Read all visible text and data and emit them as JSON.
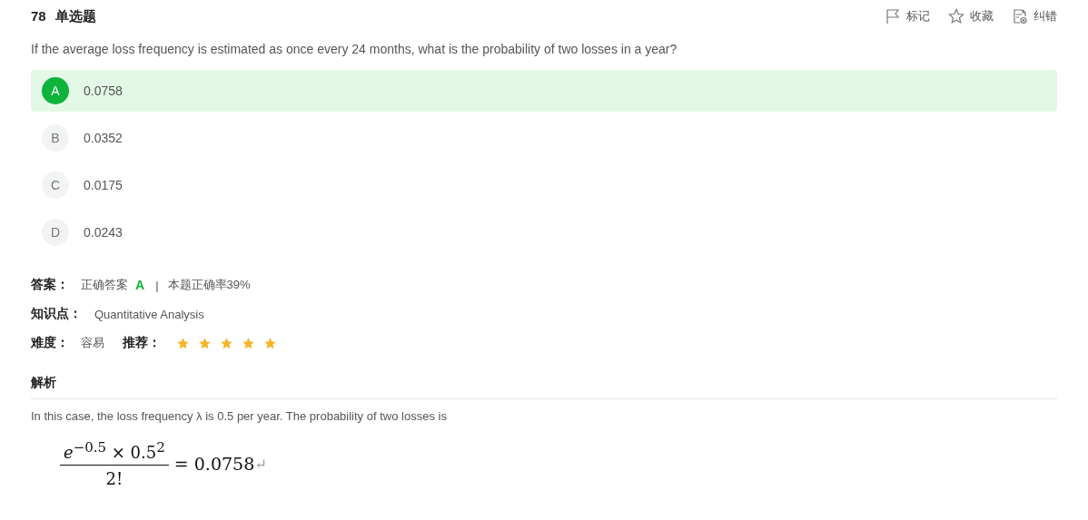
{
  "question": {
    "number": "78",
    "type": "单选题",
    "text": "If the average loss frequency is estimated as once every 24 months, what is the probability of two losses in a year?"
  },
  "actions": [
    {
      "kind": "flag",
      "label": "标记"
    },
    {
      "kind": "star",
      "label": "收藏"
    },
    {
      "kind": "report",
      "label": "纠错"
    }
  ],
  "options": [
    {
      "letter": "A",
      "text": "0.0758",
      "selected": true
    },
    {
      "letter": "B",
      "text": "0.0352",
      "selected": false
    },
    {
      "letter": "C",
      "text": "0.0175",
      "selected": false
    },
    {
      "letter": "D",
      "text": "0.0243",
      "selected": false
    }
  ],
  "answer": {
    "label": "答案：",
    "prefix": "正确答案",
    "letter": "A",
    "separator": "|",
    "rate": "本题正确率39%"
  },
  "knowledge": {
    "label": "知识点：",
    "value": "Quantitative Analysis"
  },
  "difficulty": {
    "label": "难度：",
    "value": "容易"
  },
  "recommend": {
    "label": "推荐：",
    "stars": 5
  },
  "analysis": {
    "title": "解析",
    "text": "In this case, the loss frequency λ is 0.5 per year. The probability of two losses is",
    "numerator": "*e*$^{−0.5}$ × 0.5$^{2}$",
    "denominator": "2!",
    "result": "= 0.0758",
    "mark": "↵"
  }
}
